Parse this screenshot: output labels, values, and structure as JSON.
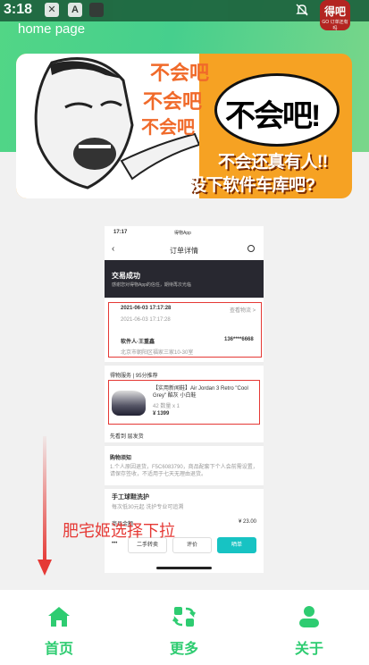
{
  "status_bar": {
    "time": "3:18",
    "icons": [
      "game-icon",
      "a-icon",
      "app-icon",
      "mute-icon"
    ],
    "app_badge": "得吧",
    "app_badge_sub": "GO 订单还有吗"
  },
  "header": {
    "title": "home page"
  },
  "banner": {
    "top_texts": [
      "不会吧",
      "不会吧",
      "不会吧"
    ],
    "bubble": "不会吧!",
    "caption_line1": "不会还真有人!!",
    "caption_line2": "没下软件车库吧?"
  },
  "screenshot": {
    "status_time": "17:17",
    "app_name": "得物App",
    "title": "订单详情",
    "status_title": "交易成功",
    "status_sub": "感谢您对得物App的信任，期待再次光临",
    "time_row1": "2021-06-03  17:17:28",
    "time_row1_link": "查看物流 >",
    "time_row2": "2021-06-03  17:17:28",
    "receiver": "软件人·王重鑫",
    "phone": "136****6668",
    "address": "北京市朝阳区福家三家10-30室",
    "seller_label": "得物服务 | 95分推荐",
    "product_name": "【实用新闻鞋】Air Jordan 3 Retro \"Cool Grey\" 酷灰 小白鞋",
    "product_size": "42  数量 x 1",
    "product_price": "¥ 1399",
    "shop_row": "先看到 层发货",
    "info_title": "购物须知",
    "info_text": "1.个人原因退货，F5C6083790，商品配套下个人会前需设置，请保存签收，不适用于七天无理由退货。",
    "service_title": "手工球鞋洗护",
    "service_sub": "每次低30元起  洗护专业可追溯",
    "price_label": "商品金额",
    "price_value": "¥ 23.00",
    "buttons": [
      "二手转卖",
      "评价",
      "晒单"
    ]
  },
  "hint": "肥宅姬选择下拉",
  "tabbar": {
    "items": [
      {
        "label": "首页",
        "icon": "home-icon"
      },
      {
        "label": "更多",
        "icon": "swap-icon"
      },
      {
        "label": "关于",
        "icon": "user-icon"
      }
    ]
  },
  "colors": {
    "accent": "#2ecc71",
    "header_green": "#4fd38a",
    "highlight_red": "#e53935",
    "teal_button": "#17c3c3"
  }
}
